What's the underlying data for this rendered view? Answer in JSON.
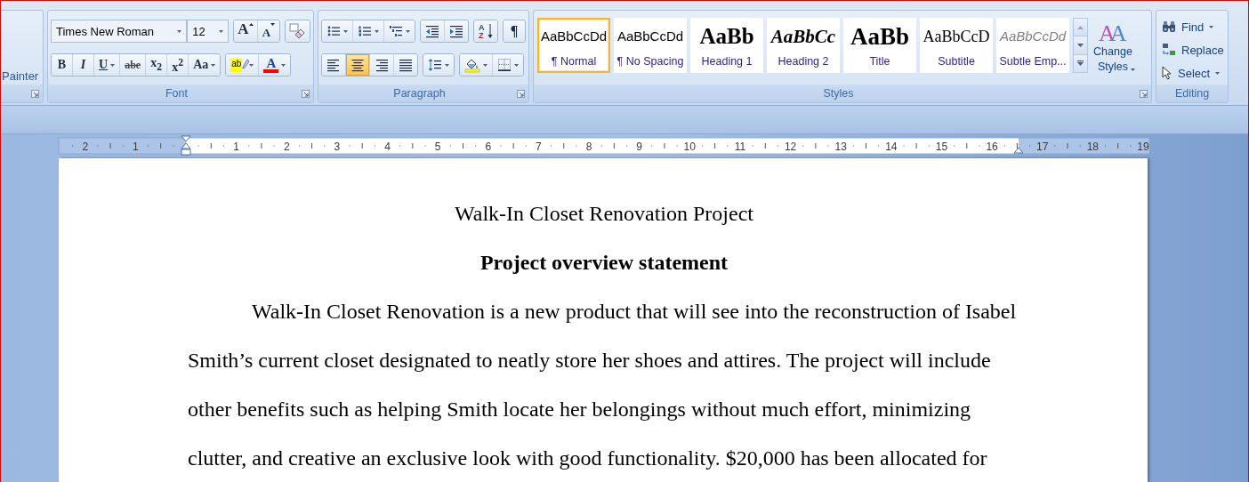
{
  "ribbon": {
    "clipboard": {
      "format_painter": "Painter"
    },
    "font": {
      "label": "Font",
      "font_name": "Times New Roman",
      "font_size": "12",
      "rows": [
        {
          "clusters": [
            {
              "buttons": [
                {
                  "kind": "grow-font",
                  "glyph": "A",
                  "has_menu": false
                },
                {
                  "kind": "shrink-font",
                  "glyph": "A",
                  "has_menu": false
                }
              ]
            },
            {
              "buttons": [
                {
                  "kind": "clear-formatting",
                  "has_menu": false
                }
              ]
            }
          ]
        },
        {
          "clusters": [
            {
              "buttons": [
                {
                  "kind": "bold",
                  "glyph": "B",
                  "has_menu": false
                },
                {
                  "kind": "italic",
                  "glyph": "I",
                  "has_menu": false
                },
                {
                  "kind": "underline",
                  "glyph": "U",
                  "has_menu": true
                },
                {
                  "kind": "strikethrough",
                  "glyph": "abe",
                  "has_menu": false
                },
                {
                  "kind": "subscript",
                  "glyph": "x$_{2}$",
                  "has_menu": false
                },
                {
                  "kind": "superscript",
                  "glyph": "x$^{2}$",
                  "has_menu": false
                },
                {
                  "kind": "change-case",
                  "glyph": "Aa",
                  "has_menu": true
                }
              ]
            },
            {
              "buttons": [
                {
                  "kind": "highlight",
                  "glyph": "ab",
                  "has_menu": true
                },
                {
                  "kind": "font-color",
                  "glyph": "A",
                  "has_menu": true
                }
              ]
            }
          ]
        }
      ]
    },
    "paragraph": {
      "label": "Paragraph",
      "rows": [
        {
          "clusters": [
            {
              "buttons": [
                {
                  "kind": "bullets",
                  "has_menu": true
                },
                {
                  "kind": "numbering",
                  "has_menu": true
                },
                {
                  "kind": "multilevel-list",
                  "has_menu": true
                }
              ]
            },
            {
              "buttons": [
                {
                  "kind": "decrease-indent",
                  "has_menu": false
                },
                {
                  "kind": "increase-indent",
                  "has_menu": false
                }
              ]
            },
            {
              "buttons": [
                {
                  "kind": "sort",
                  "letters": [
                    "A",
                    "Z"
                  ],
                  "has_menu": false
                }
              ]
            },
            {
              "buttons": [
                {
                  "kind": "show-marks",
                  "glyph": "¶",
                  "has_menu": false
                }
              ]
            }
          ]
        },
        {
          "clusters": [
            {
              "buttons": [
                {
                  "kind": "align-left",
                  "selected": false,
                  "has_menu": false
                },
                {
                  "kind": "align-center",
                  "selected": true,
                  "has_menu": false
                },
                {
                  "kind": "align-right",
                  "selected": false,
                  "has_menu": false
                },
                {
                  "kind": "justify",
                  "selected": false,
                  "has_menu": false
                }
              ]
            },
            {
              "buttons": [
                {
                  "kind": "line-spacing",
                  "has_menu": true
                }
              ]
            },
            {
              "buttons": [
                {
                  "kind": "shading",
                  "has_menu": true
                },
                {
                  "kind": "borders",
                  "has_menu": true
                }
              ]
            }
          ]
        }
      ]
    },
    "styles": {
      "label": "Styles",
      "items": [
        {
          "preview": "AaBbCcDd",
          "name": "¶ Normal",
          "kind": "normal",
          "selected": true
        },
        {
          "preview": "AaBbCcDd",
          "name": "¶ No Spacing",
          "kind": "no-spacing",
          "selected": false
        },
        {
          "preview": "AaBb",
          "name": "Heading 1",
          "kind": "heading1",
          "selected": false
        },
        {
          "preview": "AaBbCc",
          "name": "Heading 2",
          "kind": "heading2",
          "selected": false
        },
        {
          "preview": "AaBb",
          "name": "Title",
          "kind": "title",
          "selected": false
        },
        {
          "preview": "AaBbCcD",
          "name": "Subtitle",
          "kind": "subtitle",
          "selected": false
        },
        {
          "preview": "AaBbCcDd",
          "name": "Subtle Emp...",
          "kind": "subtle-emphasis",
          "selected": false
        }
      ],
      "change_styles": {
        "label": "Change Styles",
        "glyph": "AA"
      }
    },
    "editing": {
      "label": "Editing",
      "items": [
        {
          "kind": "find",
          "label": "Find",
          "has_menu": true
        },
        {
          "kind": "replace",
          "label": "Replace",
          "has_menu": false
        },
        {
          "kind": "select",
          "label": "Select",
          "has_menu": true
        }
      ]
    }
  },
  "ruler": {
    "left_labels": [
      "2",
      "1"
    ],
    "labels": [
      "1",
      "2",
      "3",
      "4",
      "5",
      "6",
      "7",
      "8",
      "9",
      "10",
      "11",
      "12",
      "13",
      "14",
      "15",
      "16",
      "17",
      "18",
      "19"
    ]
  },
  "document": {
    "title": "Walk-In Closet Renovation Project",
    "heading": "Project overview statement",
    "paragraph": "Walk-In Closet Renovation is a new product that will see into the reconstruction of Isabel Smith’s current closet designated to neatly store her shoes and attires. The project will include other benefits such as helping Smith locate her belongings without much effort, minimizing clutter, and creative an exclusive look with good functionality. $20,000 has been allocated for"
  }
}
